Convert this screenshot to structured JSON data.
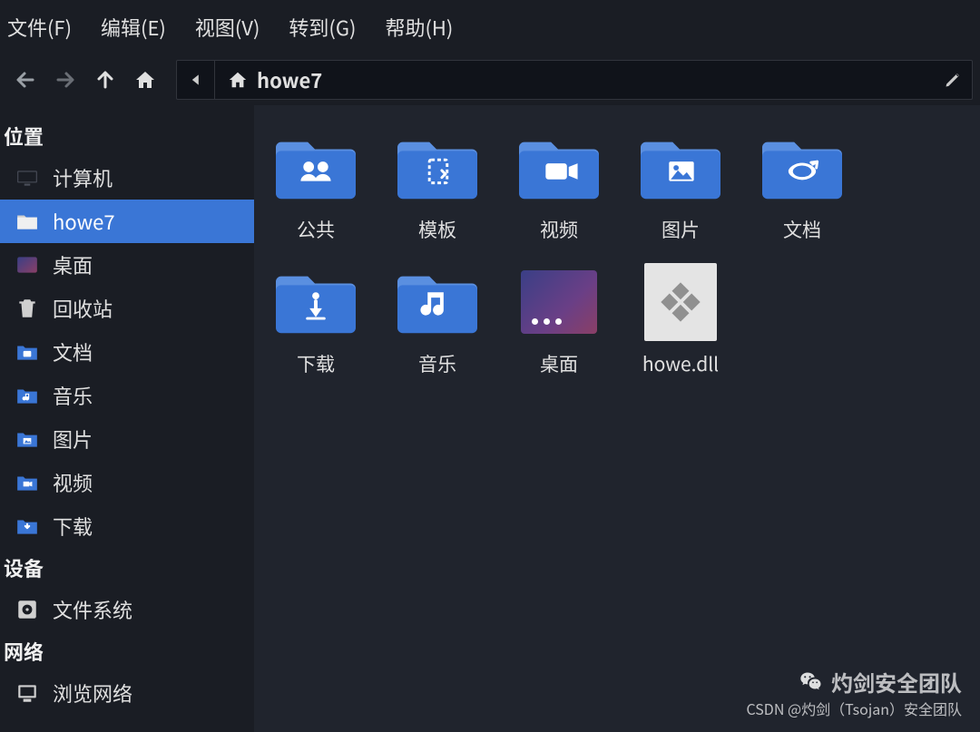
{
  "menubar": {
    "file": "文件(F)",
    "edit": "编辑(E)",
    "view": "视图(V)",
    "go": "转到(G)",
    "help": "帮助(H)"
  },
  "pathbar": {
    "location": "howe7"
  },
  "sidebar": {
    "sections": {
      "places": "位置",
      "devices": "设备",
      "network": "网络"
    },
    "places": [
      {
        "id": "computer",
        "label": "计算机"
      },
      {
        "id": "home",
        "label": "howe7"
      },
      {
        "id": "desktop",
        "label": "桌面"
      },
      {
        "id": "trash",
        "label": "回收站"
      },
      {
        "id": "documents",
        "label": "文档"
      },
      {
        "id": "music",
        "label": "音乐"
      },
      {
        "id": "pictures",
        "label": "图片"
      },
      {
        "id": "videos",
        "label": "视频"
      },
      {
        "id": "downloads",
        "label": "下载"
      }
    ],
    "devices": [
      {
        "id": "filesystem",
        "label": "文件系统"
      }
    ],
    "network": [
      {
        "id": "browse-network",
        "label": "浏览网络"
      }
    ]
  },
  "files": [
    {
      "name": "公共",
      "type": "folder",
      "glyph": "public"
    },
    {
      "name": "模板",
      "type": "folder",
      "glyph": "template"
    },
    {
      "name": "视频",
      "type": "folder",
      "glyph": "video"
    },
    {
      "name": "图片",
      "type": "folder",
      "glyph": "picture"
    },
    {
      "name": "文档",
      "type": "folder",
      "glyph": "document"
    },
    {
      "name": "下载",
      "type": "folder",
      "glyph": "download"
    },
    {
      "name": "音乐",
      "type": "folder",
      "glyph": "music"
    },
    {
      "name": "桌面",
      "type": "desktop"
    },
    {
      "name": "howe.dll",
      "type": "dll"
    }
  ],
  "watermark": {
    "line1": "灼剑安全团队",
    "line2": "CSDN @灼剑（Tsojan）安全团队"
  },
  "colors": {
    "folder": "#3a76d6",
    "folder_tab": "#5a8fe0",
    "glyph_on_folder": "#ffffff",
    "bg_dark": "#1a1d24",
    "bg_content": "#20242d",
    "selection": "#3a76d6"
  }
}
